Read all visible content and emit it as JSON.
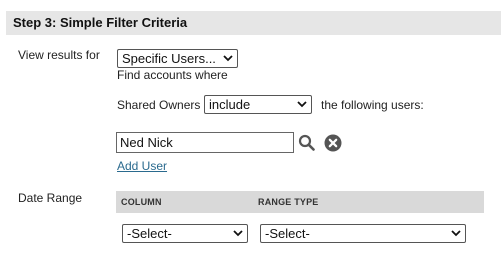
{
  "section": {
    "title": "Step 3: Simple Filter Criteria"
  },
  "view_results": {
    "label": "View results for",
    "selected": "Specific Users...",
    "helper": "Find accounts where"
  },
  "shared_owners": {
    "label": "Shared Owners",
    "operator": "include",
    "suffix": "the following users:"
  },
  "user_field": {
    "value": "Ned Nick"
  },
  "add_user_link": "Add User",
  "date_range": {
    "label": "Date Range",
    "columns": [
      "COLUMN",
      "RANGE TYPE"
    ],
    "column_select": "-Select-",
    "range_type_select": "-Select-"
  },
  "icons": {
    "search": "search-icon",
    "clear": "clear-icon",
    "dropdown": "chevron-down-icon"
  }
}
